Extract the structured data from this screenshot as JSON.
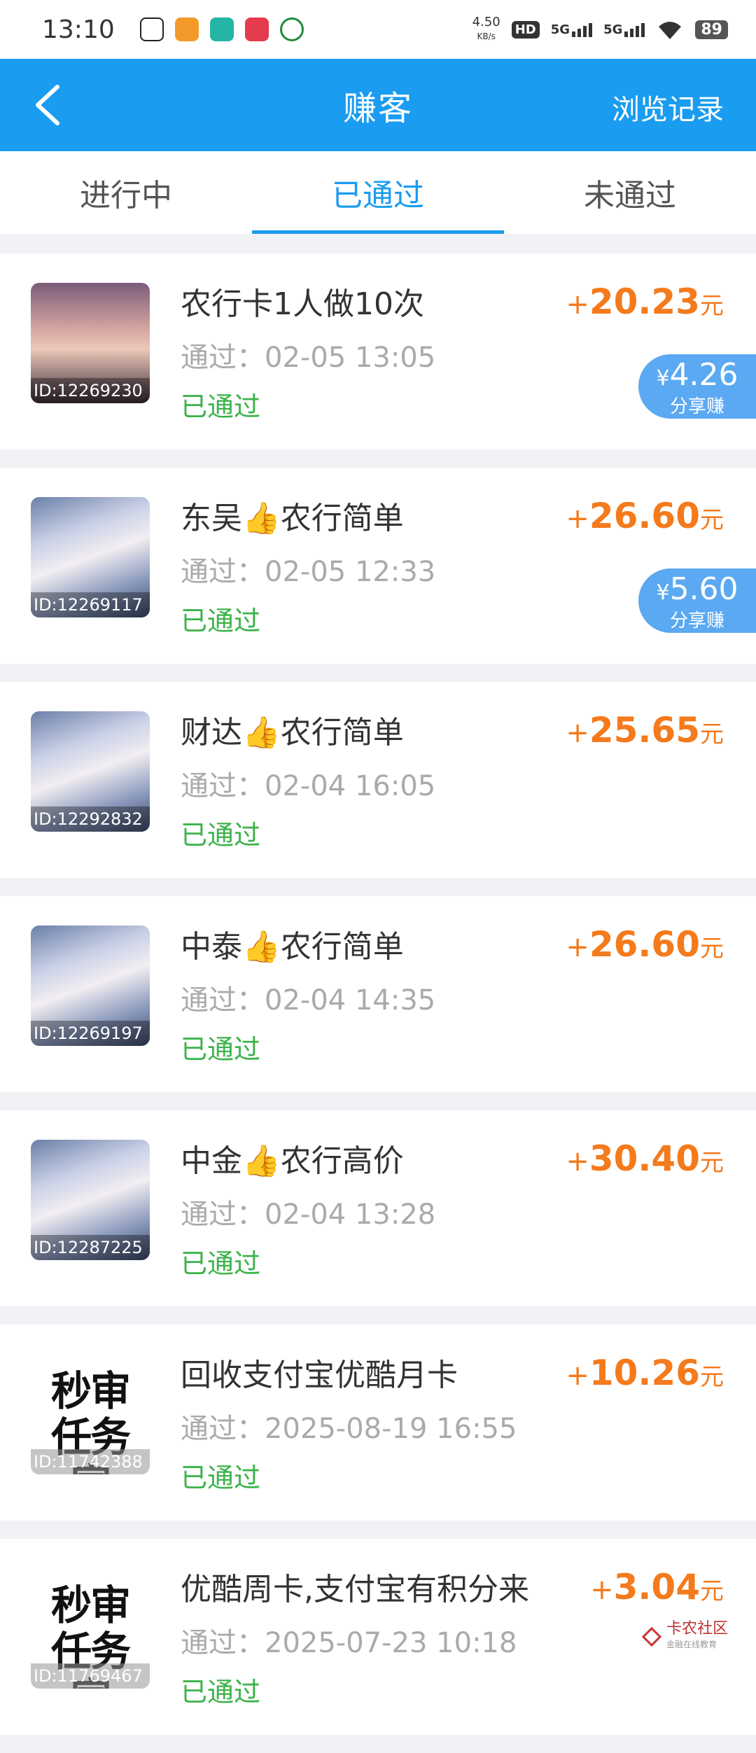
{
  "status_bar": {
    "time": "13:10",
    "speed_value": "4.50",
    "speed_unit": "KB/s",
    "hd_label": "HD",
    "network1": "5G",
    "network2": "5G",
    "battery": "89"
  },
  "header": {
    "title": "赚客",
    "history_label": "浏览记录"
  },
  "tabs": [
    {
      "label": "进行中"
    },
    {
      "label": "已通过"
    },
    {
      "label": "未通过"
    }
  ],
  "items": [
    {
      "title": "农行卡1人做10次",
      "time": "通过：02-05 13:05",
      "status": "已通过",
      "amount_sign": "+",
      "amount": "20.23",
      "unit": "元",
      "thumb_id": "ID:12269230",
      "share": {
        "symbol": "¥",
        "value": "4.26",
        "label": "分享赚"
      }
    },
    {
      "title": "东吴👍农行简单",
      "time": "通过：02-05 12:33",
      "status": "已通过",
      "amount_sign": "+",
      "amount": "26.60",
      "unit": "元",
      "thumb_id": "ID:12269117",
      "share": {
        "symbol": "¥",
        "value": "5.60",
        "label": "分享赚"
      }
    },
    {
      "title": "财达👍农行简单",
      "time": "通过：02-04 16:05",
      "status": "已通过",
      "amount_sign": "+",
      "amount": "25.65",
      "unit": "元",
      "thumb_id": "ID:12292832"
    },
    {
      "title": "中泰👍农行简单",
      "time": "通过：02-04 14:35",
      "status": "已通过",
      "amount_sign": "+",
      "amount": "26.60",
      "unit": "元",
      "thumb_id": "ID:12269197"
    },
    {
      "title": "中金👍农行高价",
      "time": "通过：02-04 13:28",
      "status": "已通过",
      "amount_sign": "+",
      "amount": "30.40",
      "unit": "元",
      "thumb_id": "ID:12287225"
    },
    {
      "title": "回收支付宝优酷月卡",
      "time": "通过：2025-08-19 16:55",
      "status": "已通过",
      "amount_sign": "+",
      "amount": "10.26",
      "unit": "元",
      "thumb_id": "ID:11742388",
      "thumb_text": "秒审任务官"
    },
    {
      "title": "优酷周卡,支付宝有积分来",
      "time": "通过：2025-07-23 10:18",
      "status": "已通过",
      "amount_sign": "+",
      "amount": "3.04",
      "unit": "元",
      "thumb_id": "ID:11769467",
      "thumb_text": "秒审任务官"
    }
  ],
  "watermark": {
    "name": "卡农社区",
    "sub": "金融在线教育"
  },
  "colors": {
    "primary": "#1a9cf0",
    "amount": "#f47a1c",
    "passed": "#3cb34a",
    "share_badge": "#5ba9f2"
  }
}
